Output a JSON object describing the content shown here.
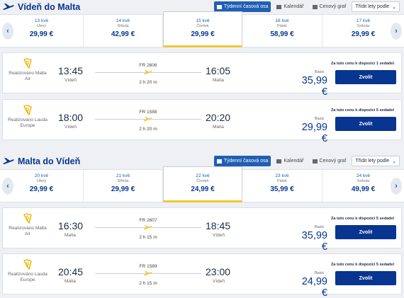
{
  "outbound": {
    "title": "Vídeň do Malta",
    "controls": {
      "weekly": "Týdenní časová osa",
      "calendar": "Kalendář",
      "graph": "Cenový graf",
      "sort": "Třídit lety podle"
    },
    "days": [
      {
        "date": "13 kvě",
        "weekday": "Úterý",
        "price": "29,99 €"
      },
      {
        "date": "14 kvě",
        "weekday": "Středa",
        "price": "42,99 €"
      },
      {
        "date": "15 kvě",
        "weekday": "Čtvrtek",
        "price": "29,99 €",
        "selected": true
      },
      {
        "date": "16 kvě",
        "weekday": "Pátek",
        "price": "58,99 €"
      },
      {
        "date": "17 kvě",
        "weekday": "Sobota",
        "price": "29,99 €"
      }
    ],
    "flights": [
      {
        "operator": "Realizováno Malta Air",
        "dep_time": "13:45",
        "dep_city": "Vídeň",
        "flight_no": "FR 2606",
        "duration": "2 h 20 m",
        "arr_time": "16:05",
        "arr_city": "Malta",
        "fare_label": "Basic",
        "price": "35,99 €",
        "seats": "Za tuto cenu k dispozici 1 sedadel",
        "button": "Zvolit"
      },
      {
        "operator": "Realizováno Lauda Europe",
        "dep_time": "18:00",
        "dep_city": "Vídeň",
        "flight_no": "FR 1588",
        "duration": "2 h 20 m",
        "arr_time": "20:20",
        "arr_city": "Malta",
        "fare_label": "Basic",
        "price": "29,99 €",
        "seats": "Za tuto cenu k dispozici 5 sedadel",
        "button": "Zvolit"
      }
    ]
  },
  "return": {
    "title": "Malta do Vídeň",
    "controls": {
      "weekly": "Týdenní časová osa",
      "calendar": "Kalendář",
      "graph": "Cenový graf",
      "sort": "Třídit lety podle"
    },
    "days": [
      {
        "date": "20 kvě",
        "weekday": "Úterý",
        "price": "29,99 €"
      },
      {
        "date": "21 kvě",
        "weekday": "Středa",
        "price": "29,99 €"
      },
      {
        "date": "22 kvě",
        "weekday": "Čtvrtek",
        "price": "24,99 €",
        "selected": true
      },
      {
        "date": "23 kvě",
        "weekday": "Pátek",
        "price": "35,99 €"
      },
      {
        "date": "24 kvě",
        "weekday": "Sobota",
        "price": "49,99 €"
      }
    ],
    "flights": [
      {
        "operator": "Realizováno Malta Air",
        "dep_time": "16:30",
        "dep_city": "Malta",
        "flight_no": "FR 2607",
        "duration": "2 h 15 m",
        "arr_time": "18:45",
        "arr_city": "Vídeň",
        "fare_label": "Basic",
        "price": "35,99 €",
        "seats": "Za tuto cenu k dispozici 5 sedadel",
        "button": "Zvolit"
      },
      {
        "operator": "Realizováno Lauda Europe",
        "dep_time": "20:45",
        "dep_city": "Malta",
        "flight_no": "FR 1589",
        "duration": "2 h 15 m",
        "arr_time": "23:00",
        "arr_city": "Vídeň",
        "fare_label": "Basic",
        "price": "24,99 €",
        "seats": "Za tuto cenu k dispozici 5 sedadel",
        "button": "Zvolit"
      }
    ]
  },
  "colors": {
    "brand_navy": "#073590",
    "accent_yellow": "#f1c933",
    "button_blue": "#1f5fb3"
  },
  "icons": {
    "plane": "plane-icon",
    "harp": "harp-icon",
    "prev": "chevron-left-icon",
    "next": "chevron-right-icon"
  }
}
